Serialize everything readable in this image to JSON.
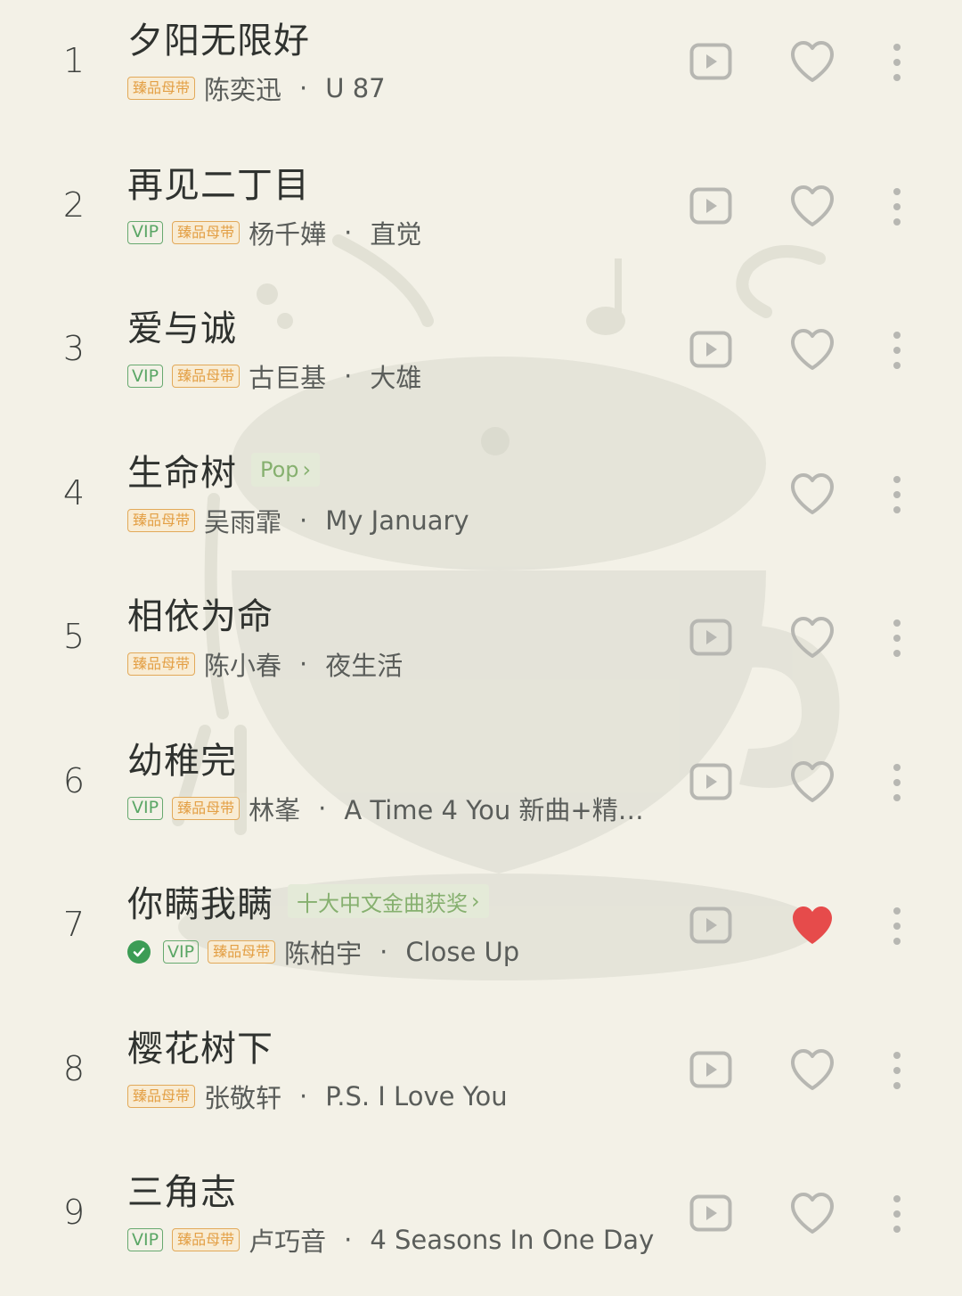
{
  "colors": {
    "background": "#f3f1e7",
    "tag_green_bg": "#e4ead8",
    "tag_green_text": "#86b06f",
    "vip_green": "#5aa665",
    "master_orange": "#e39f44",
    "liked_red": "#e64b4b",
    "icon_gray": "#b7b7b2"
  },
  "songs": [
    {
      "rank": "1",
      "title": "夕阳无限好",
      "tag": "",
      "verified": false,
      "vip": false,
      "master": true,
      "artist": "陈奕迅",
      "album": "U 87",
      "has_mv": true,
      "liked": false
    },
    {
      "rank": "2",
      "title": "再见二丁目",
      "tag": "",
      "verified": false,
      "vip": true,
      "master": true,
      "artist": "杨千嬅",
      "album": "直觉",
      "has_mv": true,
      "liked": false
    },
    {
      "rank": "3",
      "title": "爱与诚",
      "tag": "",
      "verified": false,
      "vip": true,
      "master": true,
      "artist": "古巨基",
      "album": "大雄",
      "has_mv": true,
      "liked": false
    },
    {
      "rank": "4",
      "title": "生命树",
      "tag": "Pop",
      "verified": false,
      "vip": false,
      "master": true,
      "artist": "吴雨霏",
      "album": "My January",
      "has_mv": false,
      "liked": false
    },
    {
      "rank": "5",
      "title": "相依为命",
      "tag": "",
      "verified": false,
      "vip": false,
      "master": true,
      "artist": "陈小春",
      "album": "夜生活",
      "has_mv": true,
      "liked": false
    },
    {
      "rank": "6",
      "title": "幼稚完",
      "tag": "",
      "verified": false,
      "vip": true,
      "master": true,
      "artist": "林峯",
      "album": "A Time 4 You 新曲+精…",
      "has_mv": true,
      "liked": false
    },
    {
      "rank": "7",
      "title": "你瞒我瞒",
      "tag": "十大中文金曲获奖",
      "verified": true,
      "vip": true,
      "master": true,
      "artist": "陈柏宇",
      "album": "Close Up",
      "has_mv": true,
      "liked": true
    },
    {
      "rank": "8",
      "title": "樱花树下",
      "tag": "",
      "verified": false,
      "vip": false,
      "master": true,
      "artist": "张敬轩",
      "album": "P.S. I Love You",
      "has_mv": true,
      "liked": false
    },
    {
      "rank": "9",
      "title": "三角志",
      "tag": "",
      "verified": false,
      "vip": true,
      "master": true,
      "artist": "卢巧音",
      "album": "4 Seasons In One Day",
      "has_mv": true,
      "liked": false
    }
  ],
  "labels": {
    "vip": "VIP",
    "master": "臻品母带",
    "separator": "·",
    "tag_chevron": "›"
  },
  "icons": {
    "mv": "play-video-icon",
    "like": "heart-icon",
    "more": "more-vertical-icon",
    "verified": "check-circle-icon"
  }
}
